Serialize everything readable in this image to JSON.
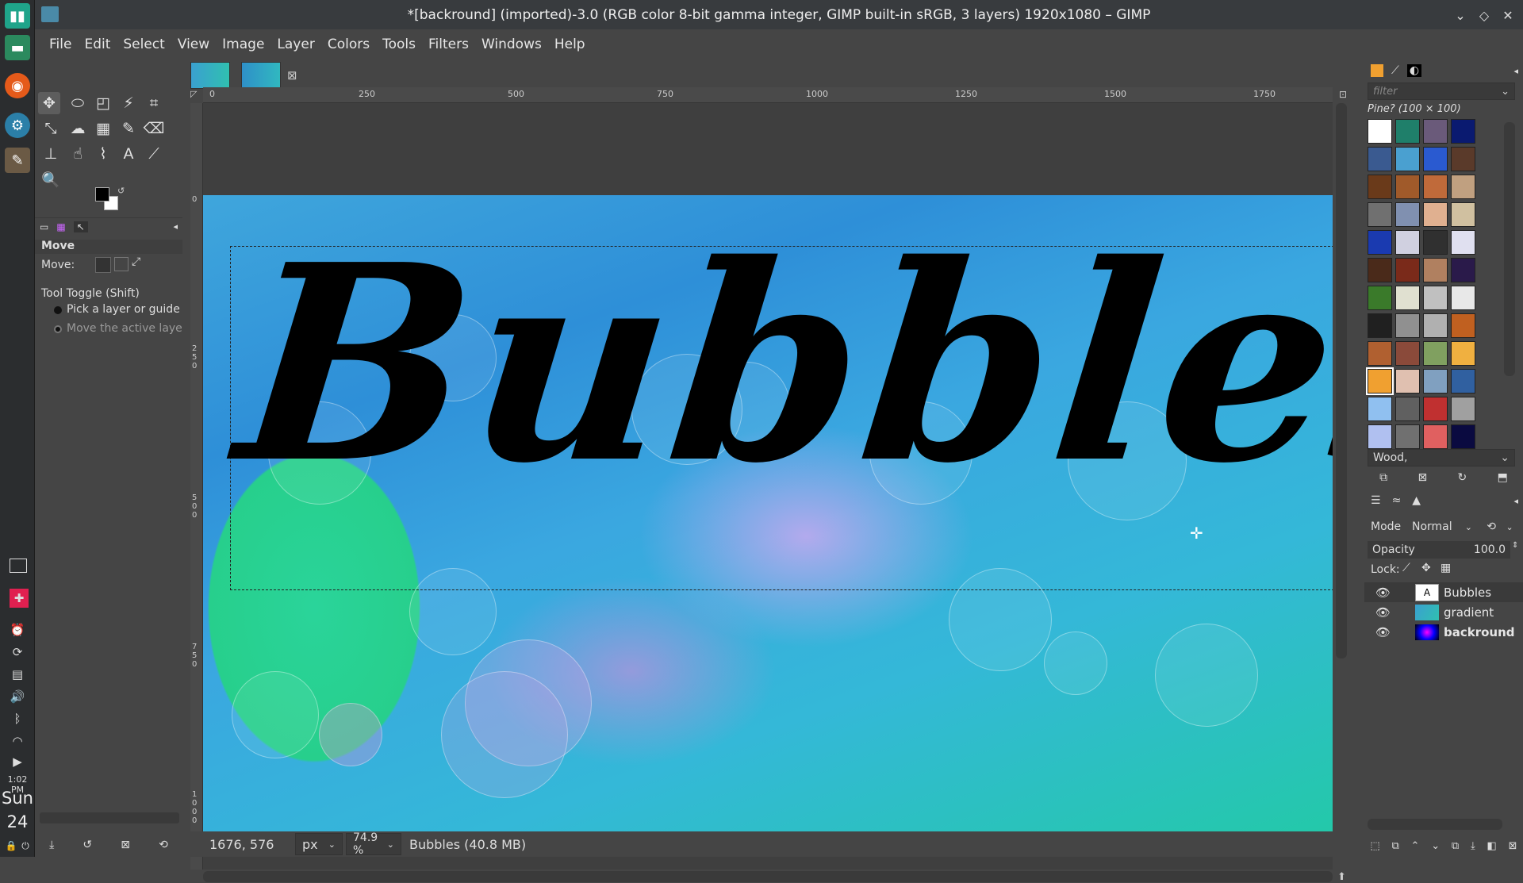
{
  "taskbar": {
    "time": "1:02 PM",
    "day": "Sun",
    "date": "24"
  },
  "window": {
    "title": "*[backround] (imported)-3.0 (RGB color 8-bit gamma integer, GIMP built-in sRGB, 3 layers) 1920x1080 – GIMP"
  },
  "menubar": {
    "items": [
      "File",
      "Edit",
      "Select",
      "View",
      "Image",
      "Layer",
      "Colors",
      "Tools",
      "Filters",
      "Windows",
      "Help"
    ]
  },
  "tool_options": {
    "title": "Move",
    "move_label": "Move:",
    "toggle_label": "Tool Toggle  (Shift)",
    "option1": "Pick a layer or guide",
    "option2": "Move the active laye"
  },
  "ruler": {
    "h_ticks": [
      "0",
      "250",
      "500",
      "750",
      "1000",
      "1250",
      "1500",
      "1750"
    ],
    "v_ticks": [
      "0",
      "250",
      "500",
      "750",
      "1000"
    ]
  },
  "canvas": {
    "text": "Bubbles"
  },
  "statusbar": {
    "coords": "1676, 576",
    "unit": "px",
    "zoom": "74.9 %",
    "info": "Bubbles (40.8 MB)"
  },
  "patterns": {
    "filter_placeholder": "filter",
    "selected_name": "Pine? (100 × 100)",
    "tag_value": "Wood,"
  },
  "layers": {
    "mode_label": "Mode",
    "mode_value": "Normal",
    "opacity_label": "Opacity",
    "opacity_value": "100.0",
    "lock_label": "Lock:",
    "items": [
      {
        "name": "Bubbles"
      },
      {
        "name": "gradient"
      },
      {
        "name": "backround"
      }
    ]
  },
  "colors": {
    "accent": "#f0a030",
    "panel_bg": "#454545",
    "selected_layer_bg": "#3a3a3a"
  }
}
